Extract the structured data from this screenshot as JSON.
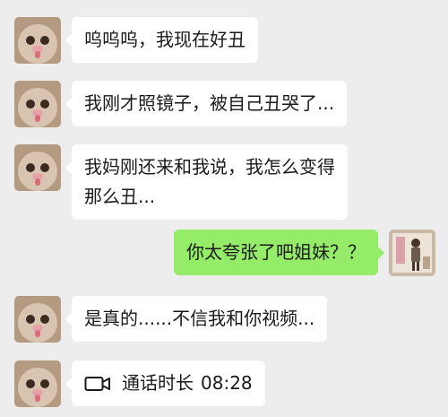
{
  "chat": {
    "messages": [
      {
        "direction": "incoming",
        "sender": "friend",
        "lines": [
          "呜呜呜，我现在好丑"
        ]
      },
      {
        "direction": "incoming",
        "sender": "friend",
        "lines": [
          "我刚才照镜子，被自己丑哭了..."
        ]
      },
      {
        "direction": "incoming",
        "sender": "friend",
        "lines": [
          "我妈刚还来和我说，我怎么变得",
          "那么丑..."
        ]
      },
      {
        "direction": "outgoing",
        "sender": "me",
        "lines": [
          "你太夸张了吧姐妹？？"
        ]
      },
      {
        "direction": "incoming",
        "sender": "friend",
        "lines": [
          "是真的......不信我和你视频..."
        ]
      },
      {
        "direction": "incoming",
        "sender": "friend",
        "type": "video-call",
        "icon": "video-call-icon",
        "label": "通话时长",
        "duration": "08:28"
      }
    ]
  },
  "colors": {
    "background": "#ededed",
    "incoming_bubble": "#ffffff",
    "outgoing_bubble": "#95ec69",
    "text": "#1a1a1a"
  }
}
